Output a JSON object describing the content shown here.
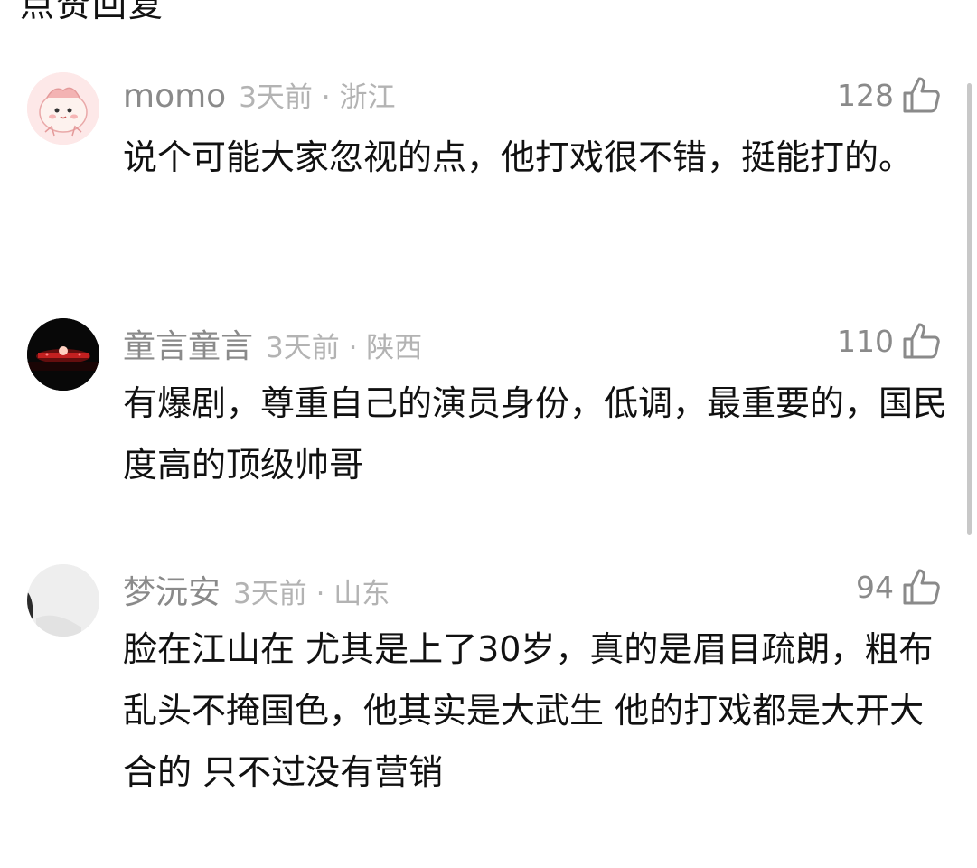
{
  "header": {
    "partial_text": "点赞回复"
  },
  "comments": [
    {
      "username": "momo",
      "time_location": "3天前 · 浙江",
      "likes": "128",
      "text": "说个可能大家忽视的点，他打戏很不错，挺能打的。",
      "avatar": "cartoon-pink-bun"
    },
    {
      "username": "童言童言",
      "time_location": "3天前 · 陕西",
      "likes": "110",
      "text": "有爆剧，尊重自己的演员身份，低调，最重要的，国民度高的顶级帅哥",
      "avatar": "concert-photo"
    },
    {
      "username": "梦沅安",
      "time_location": "3天前 · 山东",
      "likes": "94",
      "text": "脸在江山在 尤其是上了30岁，真的是眉目疏朗，粗布乱头不掩国色，他其实是大武生 他的打戏都是大开大合的 只不过没有营销",
      "avatar": "light-gray-photo"
    }
  ],
  "colors": {
    "username": "#8a8a8a",
    "meta": "#b3b3b3",
    "text": "#111111",
    "like_icon": "#8a8a8a"
  }
}
